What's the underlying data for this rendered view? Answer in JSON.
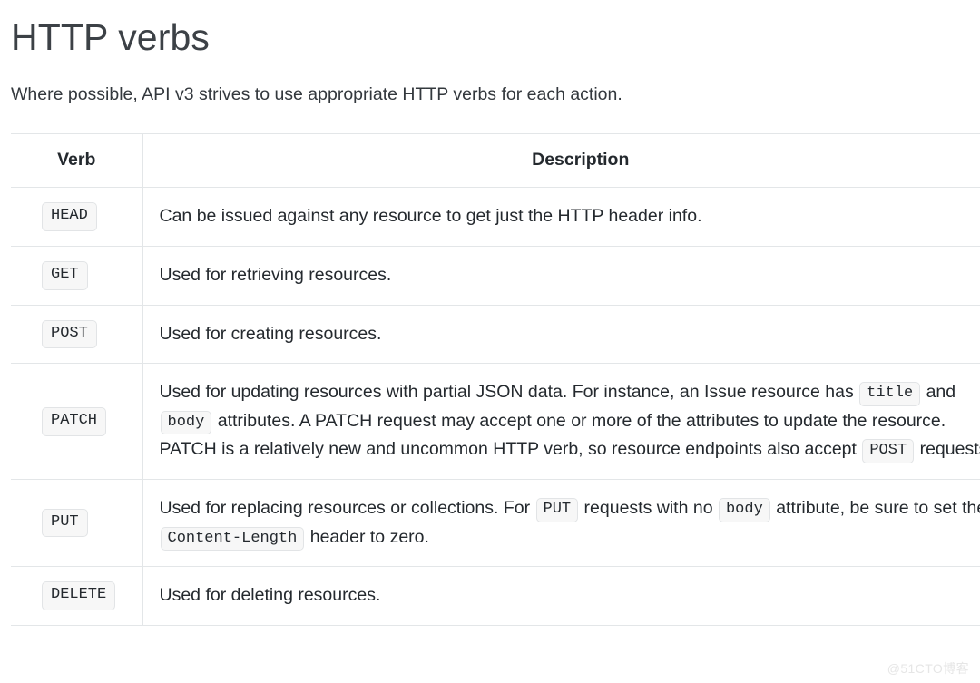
{
  "page": {
    "title": "HTTP verbs",
    "intro": "Where possible, API v3 strives to use appropriate HTTP verbs for each action."
  },
  "table": {
    "headers": {
      "verb": "Verb",
      "description": "Description"
    },
    "rows": [
      {
        "verb": "HEAD",
        "description_parts": [
          {
            "type": "text",
            "value": "Can be issued against any resource to get just the HTTP header info."
          }
        ]
      },
      {
        "verb": "GET",
        "description_parts": [
          {
            "type": "text",
            "value": "Used for retrieving resources."
          }
        ]
      },
      {
        "verb": "POST",
        "description_parts": [
          {
            "type": "text",
            "value": "Used for creating resources."
          }
        ]
      },
      {
        "verb": "PATCH",
        "description_parts": [
          {
            "type": "text",
            "value": "Used for updating resources with partial JSON data. For instance, an Issue resource has "
          },
          {
            "type": "code",
            "value": "title"
          },
          {
            "type": "text",
            "value": " and "
          },
          {
            "type": "code",
            "value": "body"
          },
          {
            "type": "text",
            "value": " attributes. A PATCH request may accept one or more of the attributes to update the resource. PATCH is a relatively new and uncommon HTTP verb, so resource endpoints also accept "
          },
          {
            "type": "code",
            "value": "POST"
          },
          {
            "type": "text",
            "value": " requests."
          }
        ]
      },
      {
        "verb": "PUT",
        "description_parts": [
          {
            "type": "text",
            "value": "Used for replacing resources or collections. For "
          },
          {
            "type": "code",
            "value": "PUT"
          },
          {
            "type": "text",
            "value": " requests with no "
          },
          {
            "type": "code",
            "value": "body"
          },
          {
            "type": "text",
            "value": " attribute, be sure to set the "
          },
          {
            "type": "code",
            "value": "Content-Length"
          },
          {
            "type": "text",
            "value": " header to zero."
          }
        ]
      },
      {
        "verb": "DELETE",
        "description_parts": [
          {
            "type": "text",
            "value": "Used for deleting resources."
          }
        ]
      }
    ]
  },
  "watermark": {
    "text": "@51CTO博客"
  },
  "colors": {
    "text": "#24292e",
    "border": "#e3e6e8",
    "chip_bg": "#f7f7f7",
    "chip_border": "#e2e4e6",
    "watermark": "#e6e6e6"
  }
}
